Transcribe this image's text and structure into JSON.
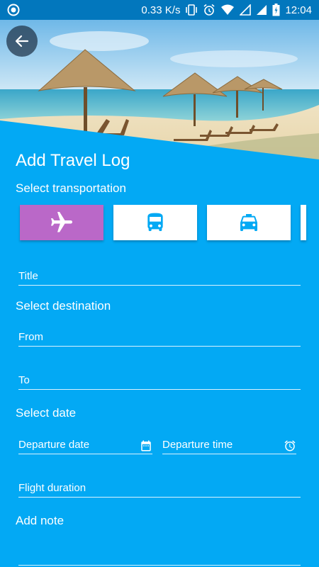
{
  "status_bar": {
    "speed": "0.33 K/s",
    "time": "12:04",
    "icons": [
      "notification-icon",
      "vibrate-icon",
      "alarm-icon",
      "wifi-icon",
      "signal-icon",
      "signal-icon",
      "battery-icon"
    ]
  },
  "header": {
    "back_icon": "arrow-left-icon"
  },
  "page": {
    "title": "Add Travel Log"
  },
  "transportation": {
    "label": "Select transportation",
    "options": [
      {
        "icon": "airplane-icon",
        "selected": true
      },
      {
        "icon": "bus-icon",
        "selected": false
      },
      {
        "icon": "taxi-icon",
        "selected": false
      }
    ]
  },
  "form": {
    "title_placeholder": "Title",
    "destination_label": "Select destination",
    "from_placeholder": "From",
    "to_placeholder": "To",
    "date_label": "Select date",
    "departure_date_placeholder": "Departure date",
    "departure_time_placeholder": "Departure time",
    "flight_duration_placeholder": "Flight duration",
    "note_label": "Add note"
  },
  "colors": {
    "background": "#03a9f4",
    "status_bar": "#0277bd",
    "selected_option": "#ba68c8",
    "icon_blue": "#03a9f4"
  }
}
